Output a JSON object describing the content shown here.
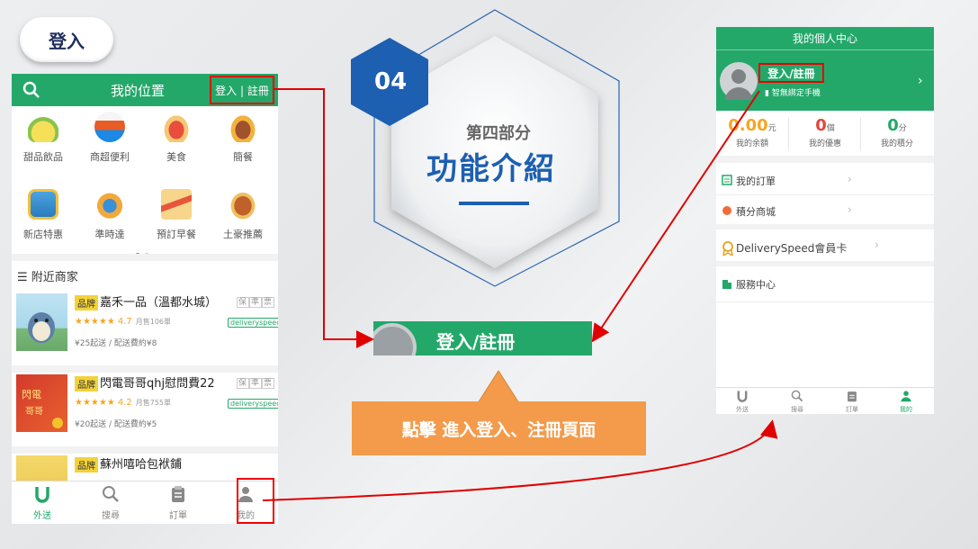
{
  "header": {
    "login_label": "登入"
  },
  "left_phone": {
    "title": "我的位置",
    "login_register": "登入 | 註冊",
    "categories": [
      {
        "label": "甜品飲品",
        "icon": "drink-icon"
      },
      {
        "label": "商超便利",
        "icon": "supermarket-icon"
      },
      {
        "label": "美食",
        "icon": "food-icon"
      },
      {
        "label": "簡餐",
        "icon": "meal-icon"
      },
      {
        "label": "新店特惠",
        "icon": "new-store-icon"
      },
      {
        "label": "準時達",
        "icon": "on-time-icon"
      },
      {
        "label": "預訂早餐",
        "icon": "breakfast-icon"
      },
      {
        "label": "土豪推薦",
        "icon": "recommend-icon"
      }
    ],
    "nearby_label": "附近商家",
    "shops": [
      {
        "brand": "品牌",
        "name": "嘉禾一品（溫都水城）",
        "tags": [
          "保",
          "準",
          "票"
        ],
        "stars": "★★★★★",
        "rating": "4.7",
        "monthly": "月售106單",
        "badge": "deliveryspeed",
        "delivery": "¥25起送 / 配送費約¥8"
      },
      {
        "brand": "品牌",
        "name": "閃電哥哥qhj慰問費22",
        "tags": [
          "保",
          "準",
          "票"
        ],
        "stars": "★★★★★",
        "rating": "4.2",
        "monthly": "月售755單",
        "badge": "deliveryspeed",
        "delivery": "¥20起送 / 配送費約¥5"
      },
      {
        "brand": "品牌",
        "name": "蘇州嘻哈包袱鋪",
        "tags": [],
        "stars": "",
        "rating": "",
        "monthly": "",
        "badge": "",
        "delivery": ""
      }
    ],
    "tabs": [
      {
        "label": "外送",
        "icon": "delivery-icon",
        "active": true
      },
      {
        "label": "搜尋",
        "icon": "search-icon",
        "active": false
      },
      {
        "label": "訂單",
        "icon": "order-icon",
        "active": false
      },
      {
        "label": "我的",
        "icon": "user-icon",
        "active": false
      }
    ]
  },
  "section": {
    "number": "04",
    "sub": "第四部分",
    "title": "功能介紹"
  },
  "middle": {
    "login_bar": "登入/註冊",
    "callout": "點擊 進入登入、注冊頁面"
  },
  "right_phone": {
    "title": "我的個人中心",
    "login": "登入/註冊",
    "bind_phone": "智無綁定手機",
    "stats": [
      {
        "value": "0.00",
        "unit": "元",
        "label": "我的余額",
        "color": "#f5a623"
      },
      {
        "value": "0",
        "unit": "個",
        "label": "我的優惠",
        "color": "#e2463c"
      },
      {
        "value": "0",
        "unit": "分",
        "label": "我的積分",
        "color": "#23a86a"
      }
    ],
    "menu": [
      {
        "label": "我的訂單",
        "icon": "order-list-icon"
      },
      {
        "label": "積分商城",
        "icon": "points-mall-icon"
      },
      {
        "label": "DeliverySpeed會員卡",
        "icon": "member-card-icon"
      },
      {
        "label": "服務中心",
        "icon": "service-center-icon"
      }
    ],
    "tabs": [
      {
        "label": "外送",
        "active": false
      },
      {
        "label": "搜尋",
        "active": false
      },
      {
        "label": "訂單",
        "active": false
      },
      {
        "label": "我的",
        "active": true
      }
    ]
  },
  "colors": {
    "green": "#23a86a",
    "red": "#e00000",
    "blue": "#1d5fb0",
    "orange": "#f39b4b"
  }
}
